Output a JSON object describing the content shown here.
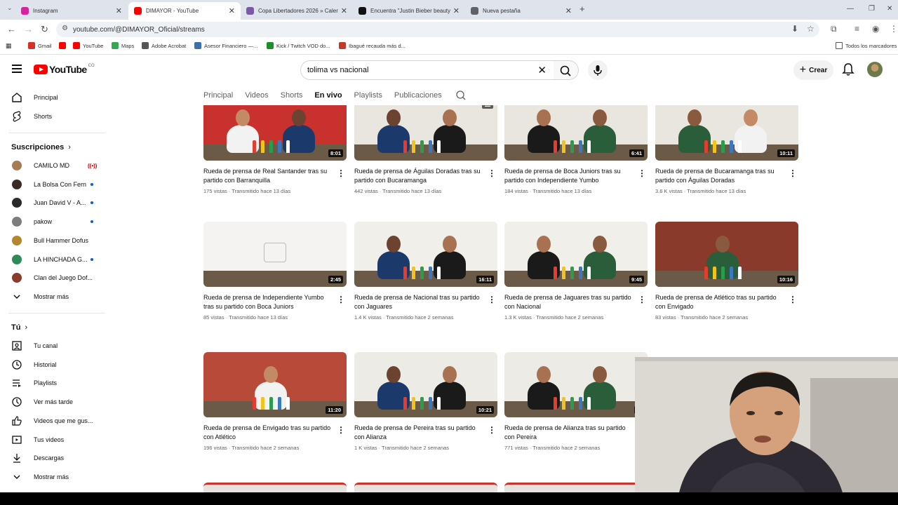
{
  "browser": {
    "tabs": [
      {
        "title": "Instagram",
        "favicon_color": "#d6249f",
        "icon": "instagram-icon"
      },
      {
        "title": "DIMAYOR - YouTube",
        "favicon_color": "#ff0000",
        "icon": "youtube-icon",
        "active": true
      },
      {
        "title": "Copa Libertadores 2026 » Calendar",
        "favicon_color": "#7a5aa8",
        "icon": "globe-icon"
      },
      {
        "title": "Encuentra \"Justin Bieber beauty and",
        "favicon_color": "#111111",
        "icon": "tiktok-icon"
      },
      {
        "title": "Nueva pestaña",
        "favicon_color": "#5f6368",
        "icon": "chrome-icon"
      }
    ],
    "url": "youtube.com/@DIMAYOR_Oficial/streams",
    "bookmarks": [
      {
        "label": "Gmail",
        "color": "#d93025"
      },
      {
        "label": "",
        "color": "#ff0000"
      },
      {
        "label": "YouTube",
        "color": "#ff0000"
      },
      {
        "label": "Maps",
        "color": "#34a853"
      },
      {
        "label": "Adobe Acrobat",
        "color": "#555555"
      },
      {
        "label": "Asesor Financiero —...",
        "color": "#3a6fb0"
      },
      {
        "label": "Kick / Twitch VOD do...",
        "color": "#1a8f2a"
      },
      {
        "label": "Ibagué recauda más d...",
        "color": "#c0392b"
      }
    ],
    "all_bookmarks": "Todos los marcadores"
  },
  "youtube": {
    "logo_text": "YouTube",
    "logo_sup": "CO",
    "search_value": "tolima vs nacional",
    "create_label": "Crear",
    "sidebar": {
      "main": [
        {
          "label": "Principal",
          "icon": "home-icon"
        },
        {
          "label": "Shorts",
          "icon": "shorts-icon"
        }
      ],
      "subs_title": "Suscripciones",
      "subs": [
        {
          "label": "CAMILO MD",
          "color": "#a57b52",
          "live": true
        },
        {
          "label": "La Bolsa Con Fern",
          "color": "#3b2b24",
          "dot": true
        },
        {
          "label": "Juan David V - A...",
          "color": "#2a2a2a",
          "dot": true
        },
        {
          "label": "pakow",
          "color": "#7d7d7d",
          "dot": true
        },
        {
          "label": "Bull Hammer Dofus",
          "color": "#b7842f"
        },
        {
          "label": "LA HINCHADA G...",
          "color": "#2e8b57",
          "dot": true
        },
        {
          "label": "Clan del Juego Dof...",
          "color": "#8a3c2a"
        }
      ],
      "show_more": "Mostrar más",
      "you_title": "Tú",
      "you": [
        {
          "label": "Tu canal",
          "icon": "channel-icon"
        },
        {
          "label": "Historial",
          "icon": "history-icon"
        },
        {
          "label": "Playlists",
          "icon": "playlists-icon"
        },
        {
          "label": "Ver más tarde",
          "icon": "watch-later-icon"
        },
        {
          "label": "Videos que me gus...",
          "icon": "like-icon"
        },
        {
          "label": "Tus videos",
          "icon": "your-videos-icon"
        },
        {
          "label": "Descargas",
          "icon": "download-icon"
        }
      ],
      "show_more_2": "Mostrar más"
    },
    "channel_tabs": [
      "Principal",
      "Videos",
      "Shorts",
      "En vivo",
      "Playlists",
      "Publicaciones"
    ],
    "active_tab": "En vivo",
    "videos": [
      {
        "title": "Rueda de prensa de Real Santander tras su partido con Barranquilla",
        "meta": "175 vistas · Transmitido hace 13 días",
        "duration": "8:01",
        "bg": "#c9312f"
      },
      {
        "title": "Rueda de prensa de Águilas Doradas tras su partido con Bucaramanga",
        "meta": "442 vistas · Transmitido hace 13 días",
        "duration": "",
        "bg": "#e9e6df"
      },
      {
        "title": "Rueda de prensa de Boca Juniors tras su partido con Independiente Yumbo",
        "meta": "184 vistas · Transmitido hace 13 días",
        "duration": "6:41",
        "bg": "#e9e6df"
      },
      {
        "title": "Rueda de prensa de Bucaramanga tras su partido con Águilas Doradas",
        "meta": "3.6 K vistas · Transmitido hace 13 días",
        "duration": "10:11",
        "bg": "#e9e6df"
      },
      {
        "title": "Rueda de prensa de Independiente Yumbo tras su partido con Boca Juniors",
        "meta": "85 vistas · Transmitido hace 13 días",
        "duration": "2:45",
        "bg": "#f4f3f1"
      },
      {
        "title": "Rueda de prensa de Nacional tras su partido con Jaguares",
        "meta": "1.4 K vistas · Transmitido hace 2 semanas",
        "duration": "16:11",
        "bg": "#f0efea"
      },
      {
        "title": "Rueda de prensa de Jaguares tras su partido con Nacional",
        "meta": "1.3 K vistas · Transmitido hace 2 semanas",
        "duration": "9:45",
        "bg": "#f0efea"
      },
      {
        "title": "Rueda de prensa de Atlético tras su partido con Envigado",
        "meta": "83 vistas · Transmitido hace 2 semanas",
        "duration": "10:16",
        "bg": "#8a3a2a"
      },
      {
        "title": "Rueda de prensa de Envigado tras su partido con Atlético",
        "meta": "196 vistas · Transmitido hace 2 semanas",
        "duration": "11:20",
        "bg": "#b84a3a"
      },
      {
        "title": "Rueda de prensa de Pereira tras su partido con Alianza",
        "meta": "1 K vistas · Transmitido hace 2 semanas",
        "duration": "10:21",
        "bg": "#ecebe6"
      },
      {
        "title": "Rueda de prensa de Alianza tras su partido con Pereira",
        "meta": "771 vistas · Transmitido hace 2 semanas",
        "duration": "17",
        "bg": "#ecebe6"
      }
    ]
  }
}
